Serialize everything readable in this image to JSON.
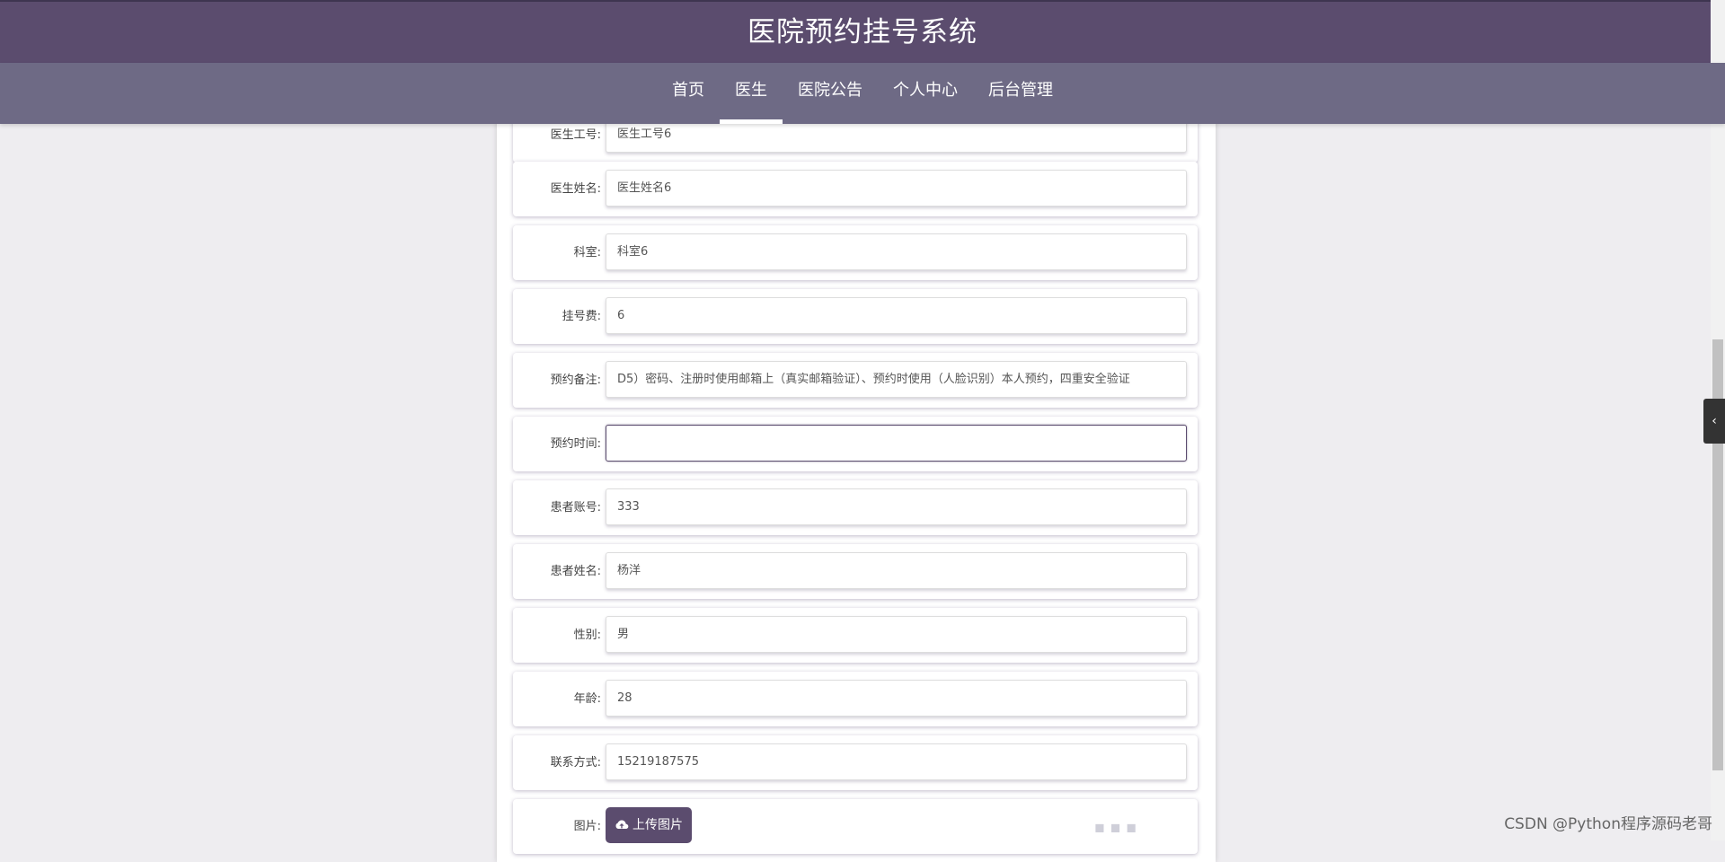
{
  "header": {
    "title": "医院预约挂号系统"
  },
  "nav": {
    "items": [
      "首页",
      "医生",
      "医院公告",
      "个人中心",
      "后台管理"
    ],
    "active_index": 1
  },
  "form": {
    "rows": [
      {
        "label": "医生工号:",
        "value": "医生工号6"
      },
      {
        "label": "医生姓名:",
        "value": "医生姓名6"
      },
      {
        "label": "科室:",
        "value": "科室6"
      },
      {
        "label": "挂号费:",
        "value": "6"
      },
      {
        "label": "预约备注:",
        "value": "D5）密码、注册时使用邮箱上（真实邮箱验证）、预约时使用（人脸识别）本人预约，四重安全验证"
      },
      {
        "label": "预约时间:",
        "value": ""
      },
      {
        "label": "患者账号:",
        "value": "333"
      },
      {
        "label": "患者姓名:",
        "value": "杨洋"
      },
      {
        "label": "性别:",
        "value": "男"
      },
      {
        "label": "年龄:",
        "value": "28"
      },
      {
        "label": "联系方式:",
        "value": "15219187575"
      }
    ],
    "image_label": "图片:",
    "upload_label": "上传图片"
  },
  "sidebar_toggle": "‹",
  "watermark": "CSDN @Python程序源码老哥",
  "icons": {
    "upload": "cloud-upload-icon",
    "toggle": "chevron-left-icon"
  },
  "colors": {
    "primary": "#5b4c6e",
    "nav": "#6e6a85",
    "bg": "#eeedf0"
  }
}
